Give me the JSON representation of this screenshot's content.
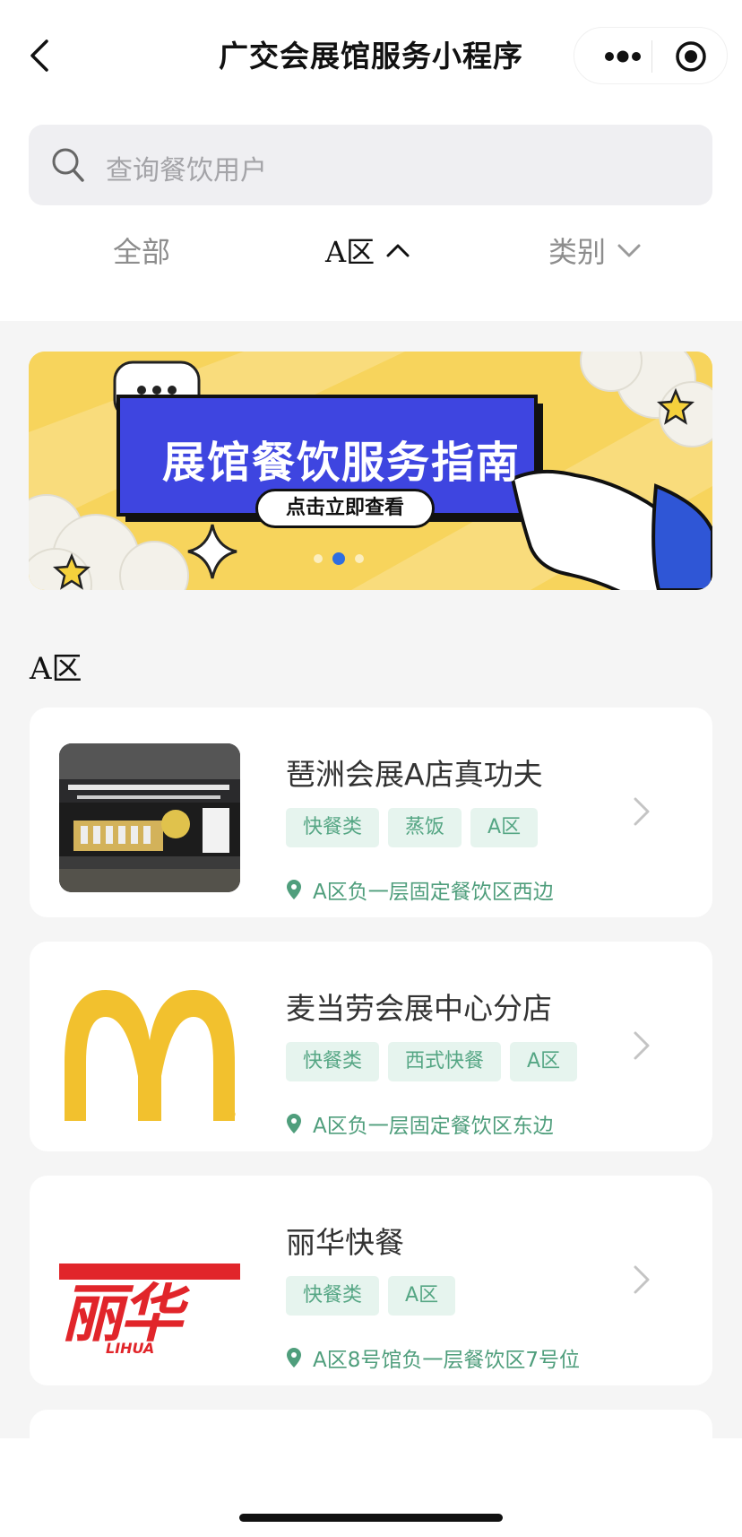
{
  "nav": {
    "title": "广交会展馆服务小程序",
    "back_icon": "chevron-left-icon",
    "more_icon": "more-dots-icon",
    "target_icon": "target-icon"
  },
  "search": {
    "placeholder": "查询餐饮用户",
    "icon": "search-icon"
  },
  "tabs": [
    {
      "label": "全部",
      "active": false
    },
    {
      "label": "A区",
      "active": true,
      "icon": "chevron-up-icon"
    },
    {
      "label": "类别",
      "active": false,
      "icon": "chevron-down-icon"
    }
  ],
  "banner": {
    "title": "展馆餐饮服务指南",
    "cta": "点击立即查看",
    "pages": 3,
    "current_page": 2
  },
  "section": {
    "title": "A区"
  },
  "restaurants": [
    {
      "name": "琶洲会展A店真功夫",
      "tags": [
        "快餐类",
        "蒸饭",
        "A区"
      ],
      "location": "A区负一层固定餐饮区西边",
      "thumb": "store-photo"
    },
    {
      "name": "麦当劳会展中心分店",
      "tags": [
        "快餐类",
        "西式快餐",
        "A区"
      ],
      "location": "A区负一层固定餐饮区东边",
      "thumb": "mcdonalds-logo"
    },
    {
      "name": "丽华快餐",
      "tags": [
        "快餐类",
        "A区"
      ],
      "location": "A区8号馆负一层餐饮区7号位",
      "thumb": "lihua-logo",
      "logo_text": [
        "丽华",
        "LIHUA"
      ]
    }
  ],
  "colors": {
    "tag_bg": "#e6f4ee",
    "tag_text": "#55a684",
    "location": "#4f9e7c",
    "banner_yellow": "#f7d45c",
    "banner_blue": "#3e45e0"
  }
}
